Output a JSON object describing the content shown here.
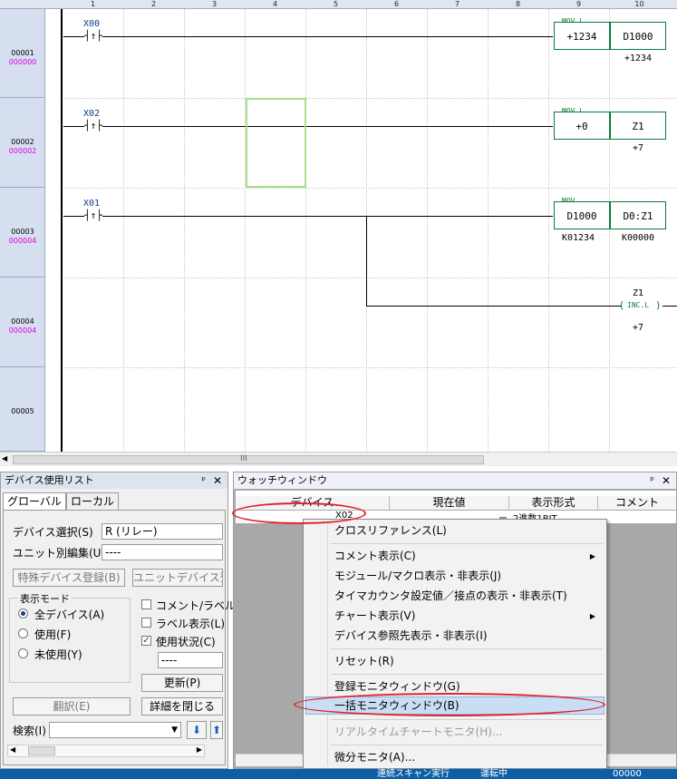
{
  "ladder": {
    "columns": [
      "1",
      "2",
      "3",
      "4",
      "5",
      "6",
      "7",
      "8",
      "9",
      "10"
    ],
    "rows": [
      {
        "step": "00001",
        "addr": "000000"
      },
      {
        "step": "00002",
        "addr": "000002"
      },
      {
        "step": "00003",
        "addr": "000004"
      },
      {
        "step": "00004",
        "addr": "000004"
      },
      {
        "step": "00005",
        "addr": ""
      }
    ],
    "contacts": [
      "X00",
      "X02",
      "X01"
    ],
    "contact_symbol": "┤↑├",
    "instr1": {
      "name": "MOV.L",
      "s": "+1234",
      "d": "D1000",
      "dval": "+1234"
    },
    "instr2": {
      "name": "MOV.L",
      "s": "+0",
      "d": "Z1",
      "dval": "+7"
    },
    "instr3": {
      "name": "MOV",
      "s": "D1000",
      "d": "D0:Z1",
      "sval": "K01234",
      "dval": "K00000"
    },
    "instr4": {
      "dev": "Z1",
      "name": "INC.L",
      "val": "+7"
    }
  },
  "scroll_thumb_label": "III",
  "device_list": {
    "title": "デバイス使用リスト",
    "pin": "ᵖ",
    "close": "✕",
    "tabs": [
      "グローバル",
      "ローカル"
    ],
    "device_select_label": "デバイス選択(S)",
    "device_select_value": "R (リレー)",
    "unit_edit_label": "ユニット別編集(U)",
    "unit_edit_value": "----",
    "btn_special": "特殊デバイス登録(B)",
    "btn_unit": "ユニットデバイス登",
    "mode_label": "表示モード",
    "radio_all": "全デバイス(A)",
    "radio_used": "使用(F)",
    "radio_unused": "未使用(Y)",
    "chk_comment": "コメント/ラベル",
    "chk_label": "ラベル表示(L)",
    "chk_usage": "使用状況(C)",
    "usage_value": "----",
    "btn_update": "更新(P)",
    "btn_translate": "翻訳(E)",
    "btn_close_detail": "詳細を閉じる",
    "search_label": "検索(I)",
    "search_arrow_down": "⬇",
    "search_arrow_up": "⬆"
  },
  "watch": {
    "title": "ウォッチウィンドウ",
    "pin": "ᵖ",
    "close": "✕",
    "headers": [
      "デバイス",
      "現在値",
      "表示形式",
      "コメント"
    ],
    "row": {
      "device": "X02",
      "value": "ー",
      "format": "2進数1BIT"
    }
  },
  "context_menu": {
    "items": [
      {
        "label": "クロスリファレンス(L)"
      },
      {
        "label": "コメント表示(C)",
        "submenu": true
      },
      {
        "label": "モジュール/マクロ表示・非表示(J)"
      },
      {
        "label": "タイマカウンタ設定値／接点の表示・非表示(T)"
      },
      {
        "label": "チャート表示(V)",
        "submenu": true
      },
      {
        "label": "デバイス参照先表示・非表示(I)"
      },
      {
        "label": "リセット(R)"
      },
      {
        "label": "登録モニタウィンドウ(G)"
      },
      {
        "label": "一括モニタウィンドウ(B)",
        "highlighted": true
      },
      {
        "label": "リアルタイムチャートモニタ(H)...",
        "disabled": true
      },
      {
        "label": "微分モニタ(A)..."
      }
    ],
    "submenu_arrow": "▶"
  },
  "status_bar": {
    "text1": "連続スキャン実行",
    "text2": "運転中",
    "text3": "00000"
  },
  "colors": {
    "highlight_oval": "#e0242c",
    "accent": "#0b5ea8",
    "instr_green": "#0a7a3a"
  }
}
